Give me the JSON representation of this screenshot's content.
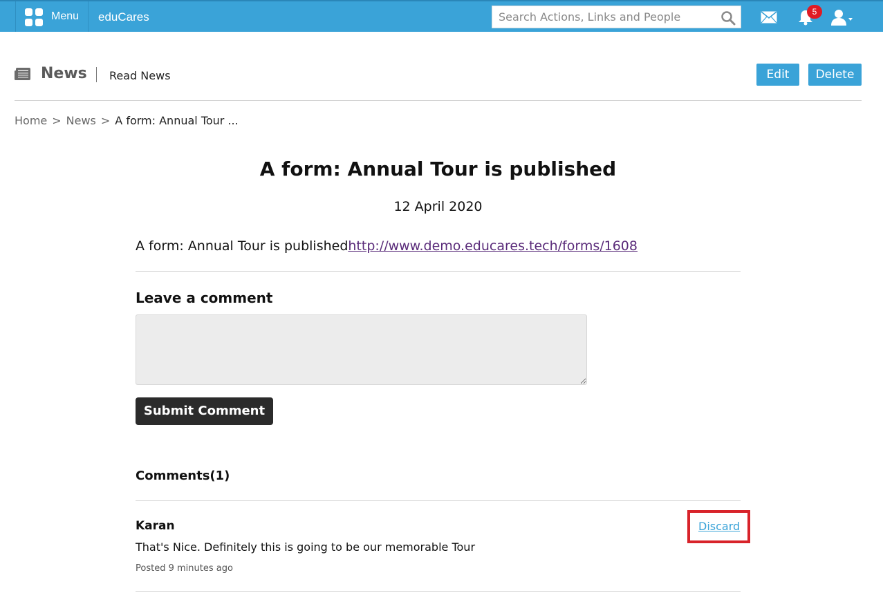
{
  "topbar": {
    "menu_label": "Menu",
    "brand": "eduCares",
    "search_placeholder": "Search Actions, Links and People",
    "notification_count": "5",
    "accent_color": "#3aa3d8",
    "icons": [
      "menu-grid-icon",
      "search-icon",
      "mail-icon",
      "bell-icon",
      "user-icon"
    ]
  },
  "header": {
    "section": "News",
    "subtitle": "Read News",
    "edit_label": "Edit",
    "delete_label": "Delete"
  },
  "breadcrumb": {
    "items": [
      "Home",
      "News"
    ],
    "separator": ">",
    "current": "A form: Annual Tour ..."
  },
  "article": {
    "title": "A form: Annual Tour is published",
    "date": "12 April 2020",
    "body_text": "A form: Annual Tour is published",
    "link_text": "http://www.demo.educares.tech/forms/1608"
  },
  "comment_form": {
    "heading": "Leave a comment",
    "textarea_value": "",
    "submit_label": "Submit Comment"
  },
  "comments": {
    "heading": "Comments(1)",
    "items": [
      {
        "author": "Karan",
        "text": "That's Nice. Definitely this is going to be our memorable Tour",
        "posted": "Posted 9 minutes ago",
        "discard_label": "Discard"
      }
    ]
  },
  "highlight_color": "#d8232a"
}
